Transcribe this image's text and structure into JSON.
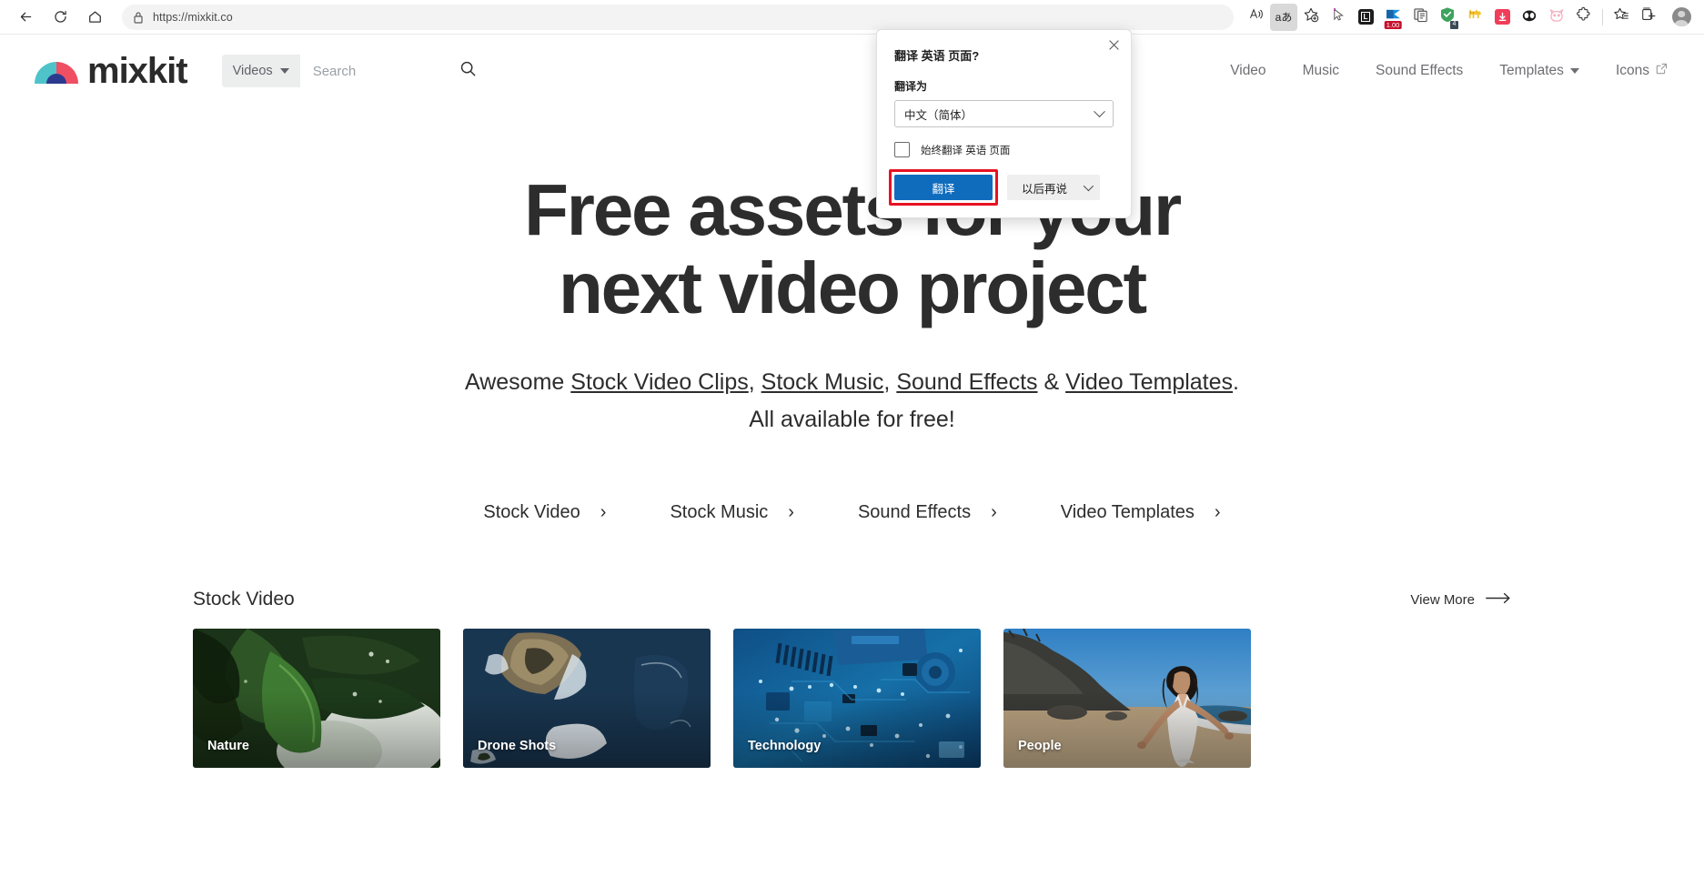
{
  "browser": {
    "back_icon": "back-arrow-icon",
    "reload_icon": "reload-icon",
    "home_icon": "home-icon",
    "url": "https://mixkit.co",
    "lock_icon": "lock-icon",
    "read_aloud_icon": "read-aloud-icon",
    "translate_icon_label": "aあ",
    "favorites_add_icon": "add-favorite-icon",
    "toolbar_extensions": [
      {
        "name": "cursor-extension-icon",
        "label": ""
      },
      {
        "name": "lastpass-extension-icon",
        "label": "L"
      },
      {
        "name": "flag-extension-icon",
        "label": "",
        "badge": "1.00"
      },
      {
        "name": "clipboard-extension-icon",
        "label": ""
      },
      {
        "name": "grammarly-extension-icon",
        "label": "",
        "badge": "4"
      },
      {
        "name": "cat-extension-icon",
        "label": ""
      },
      {
        "name": "downloader-extension-icon",
        "label": ""
      },
      {
        "name": "panda-extension-icon",
        "label": ""
      },
      {
        "name": "owl-extension-icon",
        "label": ""
      },
      {
        "name": "puzzle-extensions-icon",
        "label": ""
      }
    ],
    "collections_icon": "collections-icon",
    "split_screen_icon": "split-screen-icon",
    "profile_icon": "profile-avatar-icon"
  },
  "translate_popup": {
    "title": "翻译 英语 页面?",
    "translate_to_label": "翻译为",
    "selected_language": "中文（简体）",
    "always_translate_label": "始终翻译 英语 页面",
    "always_translate_checked": false,
    "primary_button": "翻译",
    "secondary_button": "以后再说",
    "close_icon": "close-icon",
    "highlight_color": "#e81123",
    "primary_color": "#0f6cbd"
  },
  "site": {
    "logo_text": "mixkit",
    "logo_colors": {
      "left": "#4ec3c9",
      "right": "#ef4e63",
      "arc": "#2b3a8f"
    },
    "search": {
      "category": "Videos",
      "placeholder": "Search",
      "value": "",
      "search_icon": "search-icon",
      "caret_icon": "chevron-down-icon"
    },
    "nav": [
      {
        "label": "Video",
        "has_caret": false,
        "external": false
      },
      {
        "label": "Music",
        "has_caret": false,
        "external": false
      },
      {
        "label": "Sound Effects",
        "has_caret": false,
        "external": false
      },
      {
        "label": "Templates",
        "has_caret": true,
        "external": false
      },
      {
        "label": "Icons",
        "has_caret": false,
        "external": true
      }
    ]
  },
  "hero": {
    "heading_line1": "Free assets for your",
    "heading_line2": "next video project",
    "sub_prefix": "Awesome ",
    "sub_links": [
      {
        "label": "Stock Video Clips",
        "after": ", "
      },
      {
        "label": "Stock Music",
        "after": ", "
      },
      {
        "label": "Sound Effects",
        "after": " & "
      },
      {
        "label": "Video Templates",
        "after": "."
      }
    ],
    "sub_line2": "All available for free!",
    "category_links": [
      {
        "label": "Stock Video",
        "chevron": "›"
      },
      {
        "label": "Stock Music",
        "chevron": "›"
      },
      {
        "label": "Sound Effects",
        "chevron": "›"
      },
      {
        "label": "Video Templates",
        "chevron": "›"
      }
    ]
  },
  "section": {
    "title": "Stock Video",
    "view_more": "View More",
    "view_more_icon": "arrow-right-icon",
    "cards": [
      {
        "label": "Nature",
        "art": "green-leaves-rain"
      },
      {
        "label": "Drone Shots",
        "art": "aerial-coastline-ocean"
      },
      {
        "label": "Technology",
        "art": "blue-circuit-board"
      },
      {
        "label": "People",
        "art": "woman-on-beach"
      }
    ]
  }
}
